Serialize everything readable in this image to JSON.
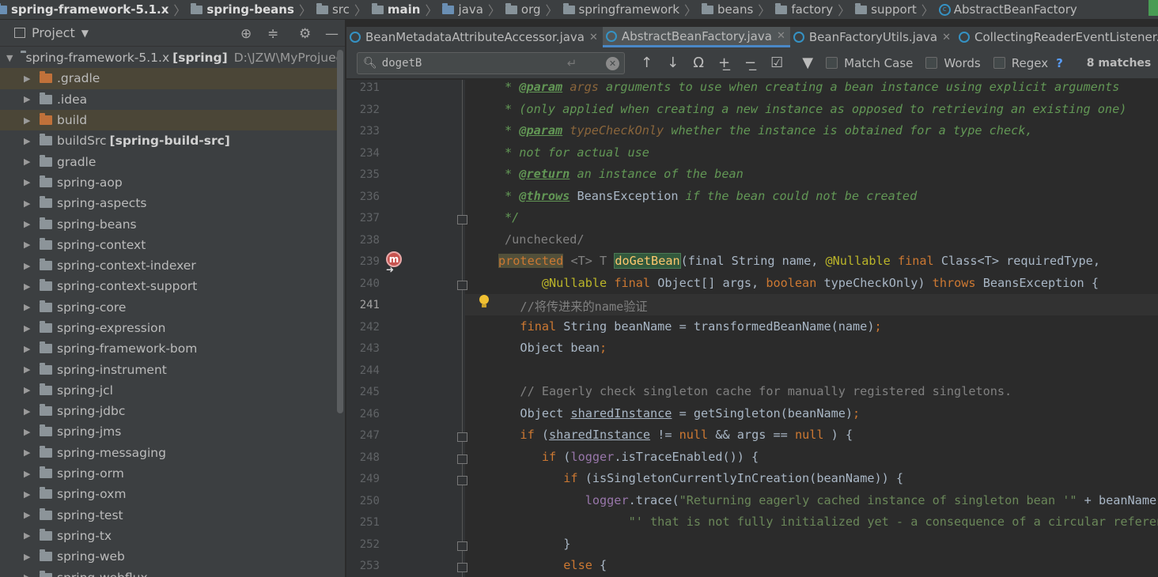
{
  "breadcrumb": {
    "items": [
      {
        "label": "spring-framework-5.1.x",
        "kind": "project"
      },
      {
        "label": "spring-beans",
        "kind": "module"
      },
      {
        "label": "src",
        "kind": "folder"
      },
      {
        "label": "main",
        "kind": "folder"
      },
      {
        "label": "java",
        "kind": "source-folder"
      },
      {
        "label": "org",
        "kind": "package"
      },
      {
        "label": "springframework",
        "kind": "package"
      },
      {
        "label": "beans",
        "kind": "package"
      },
      {
        "label": "factory",
        "kind": "package"
      },
      {
        "label": "support",
        "kind": "package"
      },
      {
        "label": "AbstractBeanFactory",
        "kind": "class"
      }
    ]
  },
  "project_panel": {
    "title": "Project",
    "root": {
      "name": "spring-framework-5.1.x",
      "tag": "[spring]",
      "path": "D:\\JZW\\MyProjuect\\"
    },
    "items": [
      {
        "label": ".gradle",
        "color": "orange",
        "highlight": true
      },
      {
        "label": ".idea",
        "color": "grey",
        "highlight": false
      },
      {
        "label": "build",
        "color": "orange",
        "highlight": true
      },
      {
        "label": "buildSrc",
        "tag": "[spring-build-src]",
        "color": "grey",
        "highlight": false
      },
      {
        "label": "gradle",
        "color": "grey",
        "highlight": false
      },
      {
        "label": "spring-aop",
        "color": "grey",
        "highlight": false
      },
      {
        "label": "spring-aspects",
        "color": "grey",
        "highlight": false
      },
      {
        "label": "spring-beans",
        "color": "grey",
        "highlight": false
      },
      {
        "label": "spring-context",
        "color": "grey",
        "highlight": false
      },
      {
        "label": "spring-context-indexer",
        "color": "grey",
        "highlight": false
      },
      {
        "label": "spring-context-support",
        "color": "grey",
        "highlight": false
      },
      {
        "label": "spring-core",
        "color": "grey",
        "highlight": false
      },
      {
        "label": "spring-expression",
        "color": "grey",
        "highlight": false
      },
      {
        "label": "spring-framework-bom",
        "color": "grey",
        "highlight": false
      },
      {
        "label": "spring-instrument",
        "color": "grey",
        "highlight": false
      },
      {
        "label": "spring-jcl",
        "color": "grey",
        "highlight": false
      },
      {
        "label": "spring-jdbc",
        "color": "grey",
        "highlight": false
      },
      {
        "label": "spring-jms",
        "color": "grey",
        "highlight": false
      },
      {
        "label": "spring-messaging",
        "color": "grey",
        "highlight": false
      },
      {
        "label": "spring-orm",
        "color": "grey",
        "highlight": false
      },
      {
        "label": "spring-oxm",
        "color": "grey",
        "highlight": false
      },
      {
        "label": "spring-test",
        "color": "grey",
        "highlight": false
      },
      {
        "label": "spring-tx",
        "color": "grey",
        "highlight": false
      },
      {
        "label": "spring-web",
        "color": "grey",
        "highlight": false
      },
      {
        "label": "spring-webflux",
        "color": "grey",
        "highlight": false
      }
    ]
  },
  "tabs": [
    {
      "label": "BeanMetadataAttributeAccessor.java",
      "active": false
    },
    {
      "label": "AbstractBeanFactory.java",
      "active": true
    },
    {
      "label": "BeanFactoryUtils.java",
      "active": false
    },
    {
      "label": "CollectingReaderEventListener.java",
      "active": false
    }
  ],
  "search": {
    "query": "dogetB",
    "match_case_label": "Match Case",
    "words_label": "Words",
    "regex_label": "Regex",
    "help_label": "?",
    "matches_label": "8 matches"
  },
  "editor": {
    "current_line": 241,
    "lines": [
      {
        "n": 231,
        "tokens": [
          [
            "c-doc",
            "* "
          ],
          [
            "c-tag",
            "@param"
          ],
          [
            "c-doc",
            " "
          ],
          [
            "c-par",
            "args"
          ],
          [
            "c-doc",
            " arguments to use when creating a bean instance using explicit arguments"
          ]
        ]
      },
      {
        "n": 232,
        "tokens": [
          [
            "c-doc",
            "* (only applied when creating a new instance as opposed to retrieving an existing one)"
          ]
        ]
      },
      {
        "n": 233,
        "tokens": [
          [
            "c-doc",
            "* "
          ],
          [
            "c-tag",
            "@param"
          ],
          [
            "c-doc",
            " "
          ],
          [
            "c-par",
            "typeCheckOnly"
          ],
          [
            "c-doc",
            " whether the instance is obtained for a type check,"
          ]
        ]
      },
      {
        "n": 234,
        "tokens": [
          [
            "c-doc",
            "* not for actual use"
          ]
        ]
      },
      {
        "n": 235,
        "tokens": [
          [
            "c-doc",
            "* "
          ],
          [
            "c-tag",
            "@return"
          ],
          [
            "c-doc",
            " an instance of the bean"
          ]
        ]
      },
      {
        "n": 236,
        "tokens": [
          [
            "c-doc",
            "* "
          ],
          [
            "c-tag",
            "@throws"
          ],
          [
            "c-doc",
            " "
          ],
          [
            "",
            "BeansException"
          ],
          [
            "c-doc",
            " if the bean could not be created"
          ]
        ]
      },
      {
        "n": 237,
        "tokens": [
          [
            "c-doc",
            "*/"
          ]
        ]
      },
      {
        "n": 238,
        "tokens": [
          [
            "c-cm",
            "/unchecked/"
          ]
        ]
      },
      {
        "n": 239,
        "tokens": [
          [
            "c-kw hl-warn",
            "protected"
          ],
          [
            "c-kw",
            " "
          ],
          [
            "c-cm",
            "<T>"
          ],
          [
            "c-cm",
            " T "
          ],
          [
            "hl-match",
            "doGetBean"
          ],
          [
            "",
            "(final String name, "
          ],
          [
            "c-ann",
            "@Nullable"
          ],
          [
            "c-kw",
            " final "
          ],
          [
            "",
            "Class<T> requiredType,"
          ]
        ]
      },
      {
        "n": 240,
        "tokens": [
          [
            "",
            "      "
          ],
          [
            "c-ann",
            "@Nullable"
          ],
          [
            "c-kw",
            " final "
          ],
          [
            "",
            "Object[] args, "
          ],
          [
            "c-kw",
            "boolean"
          ],
          [
            "",
            " typeCheckOnly) "
          ],
          [
            "c-kw",
            "throws"
          ],
          [
            "",
            " BeansException {"
          ]
        ]
      },
      {
        "n": 241,
        "tokens": [
          [
            "c-cm",
            "   //将传进来的name验证"
          ]
        ]
      },
      {
        "n": 242,
        "tokens": [
          [
            "c-kw",
            "   final "
          ],
          [
            "",
            "String beanName = transformedBeanName(name)"
          ],
          [
            "c-kw",
            ";"
          ]
        ]
      },
      {
        "n": 243,
        "tokens": [
          [
            "",
            "   Object bean"
          ],
          [
            "c-kw",
            ";"
          ]
        ]
      },
      {
        "n": 244,
        "tokens": [
          [
            "",
            ""
          ]
        ]
      },
      {
        "n": 245,
        "tokens": [
          [
            "c-cm",
            "   // Eagerly check singleton cache for manually registered singletons."
          ]
        ]
      },
      {
        "n": 246,
        "tokens": [
          [
            "",
            "   Object "
          ],
          [
            "c-ul",
            "sharedInstance"
          ],
          [
            "",
            " = getSingleton(beanName)"
          ],
          [
            "c-kw",
            ";"
          ]
        ]
      },
      {
        "n": 247,
        "tokens": [
          [
            "c-kw",
            "   if "
          ],
          [
            "",
            "("
          ],
          [
            "c-ul",
            "sharedInstance"
          ],
          [
            "",
            " != "
          ],
          [
            "c-kw",
            "null"
          ],
          [
            "",
            " && args == "
          ],
          [
            "c-kw",
            "null"
          ],
          [
            "",
            " ) {"
          ]
        ]
      },
      {
        "n": 248,
        "tokens": [
          [
            "c-kw",
            "      if "
          ],
          [
            "",
            "("
          ],
          [
            "c-fld",
            "logger"
          ],
          [
            "",
            ".isTraceEnabled()) {"
          ]
        ]
      },
      {
        "n": 249,
        "tokens": [
          [
            "c-kw",
            "         if "
          ],
          [
            "",
            "(isSingletonCurrentlyInCreation(beanName)) {"
          ]
        ]
      },
      {
        "n": 250,
        "tokens": [
          [
            "",
            "            "
          ],
          [
            "c-fld",
            "logger"
          ],
          [
            "",
            ".trace("
          ],
          [
            "c-str",
            "\"Returning eagerly cached instance of singleton bean '\""
          ],
          [
            "",
            " + beanName +"
          ]
        ]
      },
      {
        "n": 251,
        "tokens": [
          [
            "c-str",
            "                  \"' that is not fully initialized yet - a consequence of a circular reference\""
          ]
        ]
      },
      {
        "n": 252,
        "tokens": [
          [
            "",
            "         }"
          ]
        ]
      },
      {
        "n": 253,
        "tokens": [
          [
            "c-kw",
            "         else "
          ],
          [
            "",
            "{"
          ]
        ]
      }
    ]
  },
  "icons": {
    "method_badge": "m",
    "override_arrow": "override-arrow-icon",
    "bulb": "intention-bulb-icon"
  }
}
